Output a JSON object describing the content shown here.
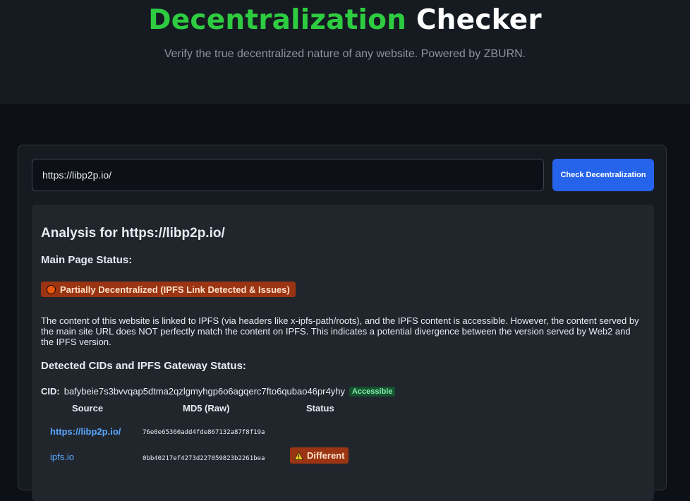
{
  "header": {
    "title_accent": "Decentralization",
    "title_rest": "Checker",
    "subtitle": "Verify the true decentralized nature of any website. Powered by ZBURN."
  },
  "search": {
    "value": "https://libp2p.io/",
    "button_label": "Check Decentralization"
  },
  "result": {
    "title": "Analysis for https://libp2p.io/",
    "main_status_heading": "Main Page Status:",
    "status_badge": "Partially Decentralized (IPFS Link Detected & Issues)",
    "description": "The content of this website is linked to IPFS (via headers like x-ipfs-path/roots), and the IPFS content is accessible. However, the content served by the main site URL does NOT perfectly match the content on IPFS. This indicates a potential divergence between the version served by Web2 and the IPFS version.",
    "cids_heading": "Detected CIDs and IPFS Gateway Status:",
    "cid_label": "CID:",
    "cid_value": "bafybeie7s3bvvqap5dtma2qzlgmyhgp6o6agqerc7fto6qubao46pr4yhy",
    "cid_badge": "Accessible",
    "table": {
      "headers": [
        "Source",
        "MD5 (Raw)",
        "Status"
      ],
      "rows": [
        {
          "source": "https://libp2p.io/",
          "md5": "76e0e65360add4fde867132a87f8f19a",
          "status": ""
        },
        {
          "source": "ipfs.io",
          "md5": "0bb40217ef4273d227059823b2261bea",
          "status": "Different"
        }
      ]
    }
  },
  "colors": {
    "accent_green": "#2ecc40",
    "button_blue": "#2563eb",
    "warning_orange": "#9a3412",
    "link_blue": "#58a6ff"
  }
}
